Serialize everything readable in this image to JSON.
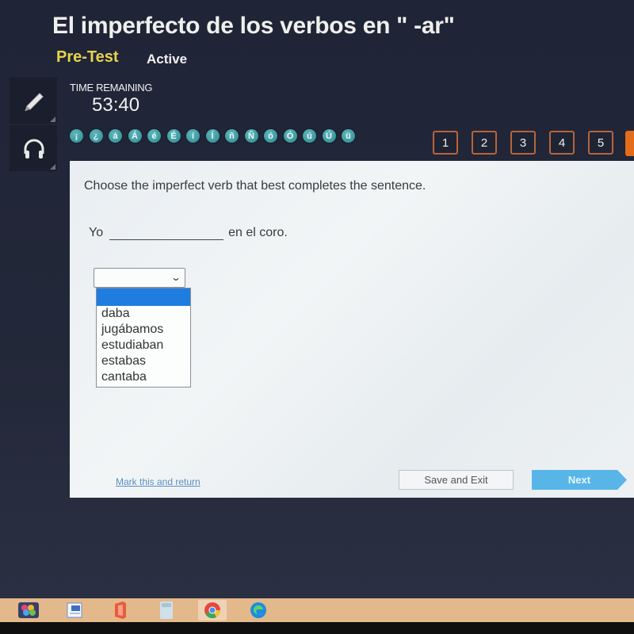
{
  "header": {
    "title": "El imperfecto de los verbos en \" -ar\"",
    "test_type": "Pre-Test",
    "status": "Active",
    "timer": {
      "label": "TIME REMAINING",
      "value": "53:40"
    }
  },
  "tools": [
    {
      "name": "pencil-icon"
    },
    {
      "name": "headphones-icon"
    }
  ],
  "special_characters": [
    "¡",
    "¿",
    "á",
    "Á",
    "é",
    "É",
    "í",
    "Í",
    "ñ",
    "Ñ",
    "ó",
    "Ó",
    "ú",
    "Ú",
    "ü"
  ],
  "question_nav": {
    "items": [
      "1",
      "2",
      "3",
      "4",
      "5"
    ],
    "accent_color": "#e46d1c"
  },
  "question": {
    "prompt": "Choose the imperfect verb that best completes the sentence.",
    "sentence_before": "Yo",
    "sentence_after": "en el coro.",
    "dropdown": {
      "selected": "",
      "options": [
        "",
        "daba",
        "jugábamos",
        "estudiaban",
        "estabas",
        "cantaba"
      ]
    }
  },
  "footer": {
    "mark_label": "Mark this and return",
    "save_label": "Save and Exit",
    "next_label": "Next"
  },
  "taskbar": {
    "apps": [
      "app-launcher-icon",
      "word-icon",
      "office-icon",
      "calculator-icon",
      "chrome-icon",
      "edge-icon"
    ]
  }
}
